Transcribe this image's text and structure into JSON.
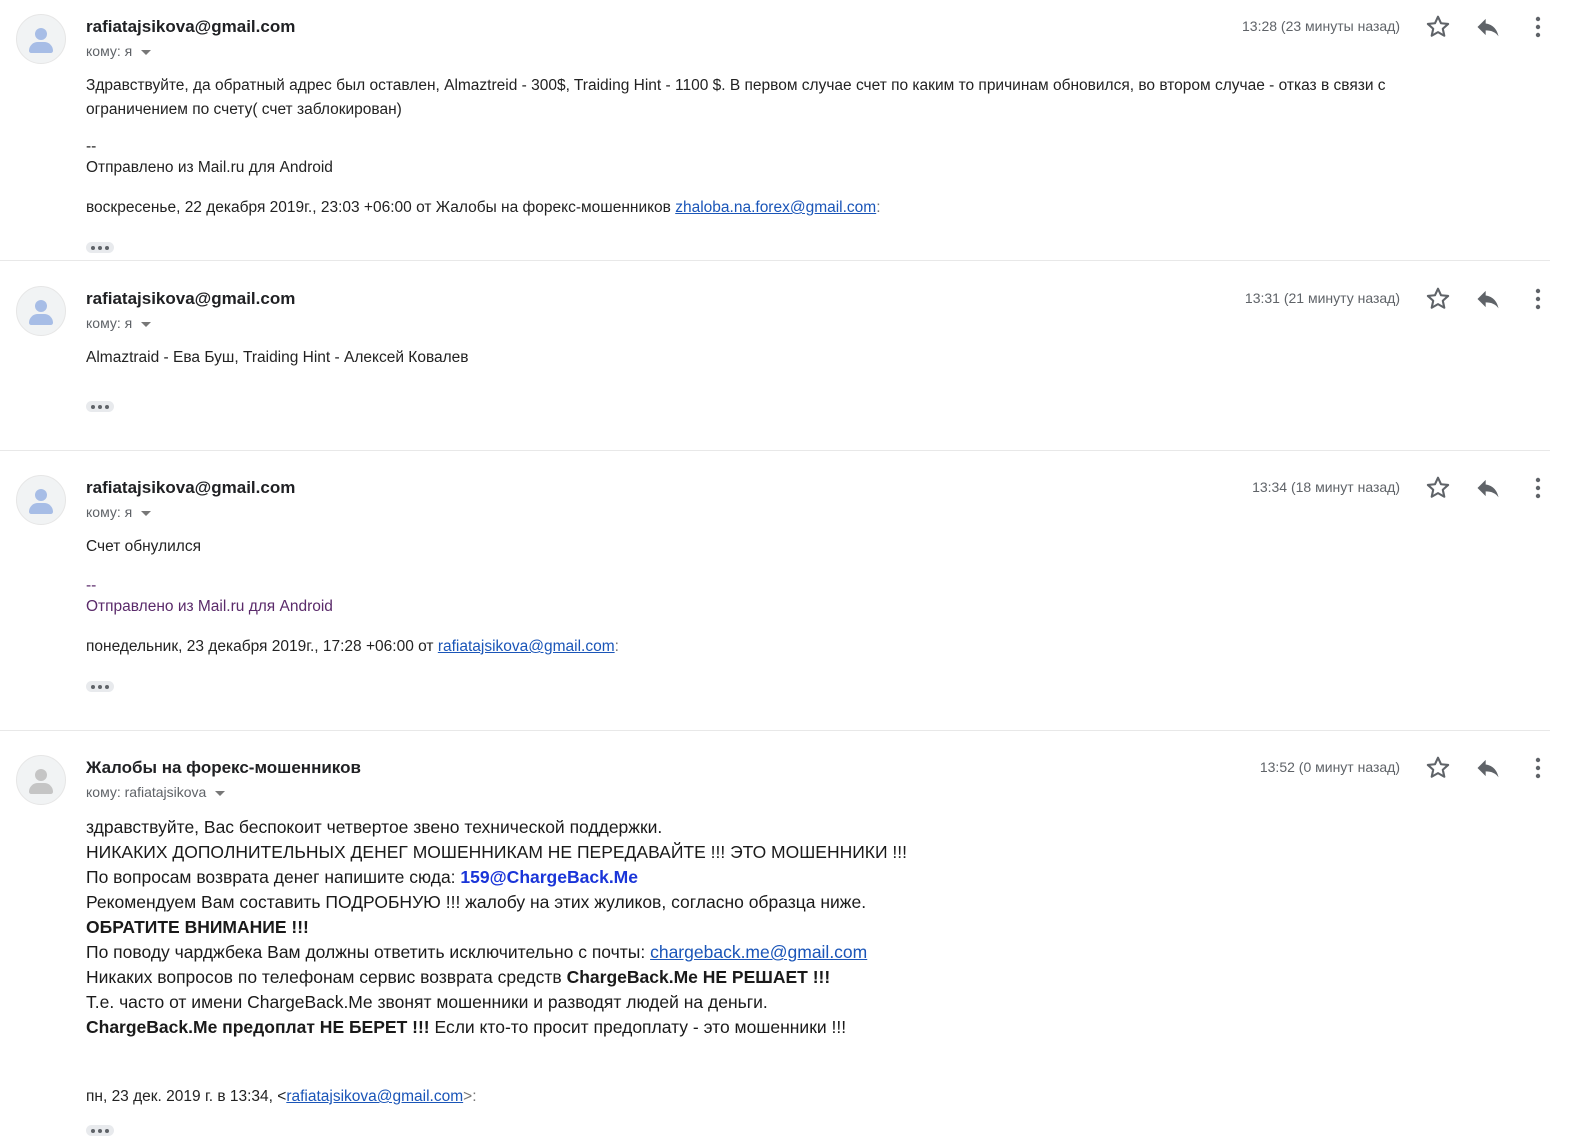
{
  "messages": [
    {
      "sender": "rafiatajsikova@gmail.com",
      "recipient": "кому: я",
      "time": "13:28 (23 минуты назад)",
      "body": [
        "Здравствуйте, да обратный адрес был оставлен, Almaztreid - 300$, Traiding Hint - 1100 $. В первом случае счет по каким то причинам обновился, во втором случае - отказ в связи с",
        "ограничением по счету( счет заблокирован)"
      ],
      "sig_dashes": "--",
      "sig_line": "Отправлено из Mail.ru для Android",
      "quote_prefix": "воскресенье, 22 декабря 2019г., 23:03 +06:00 от Жалобы на форекс-мошенников",
      "quote_email": "zhaloba.na.forex@gmail.com",
      "quote_suffix": ":"
    },
    {
      "sender": "rafiatajsikova@gmail.com",
      "recipient": "кому: я",
      "time": "13:31 (21 минуту назад)",
      "body": [
        "Almaztraid - Ева Буш, Traiding Hint - Алексей Ковалев"
      ]
    },
    {
      "sender": "rafiatajsikova@gmail.com",
      "recipient": "кому: я",
      "time": "13:34 (18 минут назад)",
      "body": [
        "Счет обнулился"
      ],
      "sig_dashes": "--",
      "sig_line": "Отправлено из Mail.ru для Android",
      "quote_prefix": "понедельник, 23 декабря 2019г., 17:28 +06:00 от",
      "quote_email": "rafiatajsikova@gmail.com",
      "quote_suffix": ":"
    },
    {
      "sender": "Жалобы на форекс-мошенников",
      "recipient": "кому: rafiatajsikova",
      "time": "13:52 (0 минут назад)",
      "lines": {
        "l1": "здравствуйте, Вас беспокоит четвертое звено технической поддержки.",
        "l2": "НИКАКИХ ДОПОЛНИТЕЛЬНЫХ ДЕНЕГ МОШЕННИКАМ НЕ ПЕРЕДАВАЙТЕ !!! ЭТО МОШЕННИКИ !!!",
        "l3_prefix": "По вопросам возврата денег напишите сюда:",
        "l3_email": "159@ChargeBack.Me",
        "l4": "Рекомендуем Вам составить ПОДРОБНУЮ !!! жалобу на этих жуликов, согласно образца ниже.",
        "l5": "ОБРАТИТЕ ВНИМАНИЕ !!!",
        "l6_prefix": "По поводу чарджбека Вам должны ответить исключительно с почты:",
        "l6_email": "chargeback.me@gmail.com",
        "l7_prefix": "Никаких вопросов по телефонам сервис возврата средств",
        "l7_bold": "ChargeBack.Me НЕ РЕШАЕТ !!!",
        "l8": "Т.е. часто от имени ChargeBack.Me звонят мошенники и разводят людей на деньги.",
        "l9_bold": "ChargeBack.Me предоплат НЕ БЕРЕТ !!!",
        "l9_suffix": "Если кто-то просит предоплату - это мошенники !!!"
      },
      "quote_prefix": "пн, 23 дек. 2019 г. в 13:34, <",
      "quote_email": "rafiatajsikova@gmail.com",
      "quote_suffix": ">:"
    }
  ],
  "icons": {
    "star": "star-icon",
    "reply": "reply-icon",
    "more": "more-vert-icon",
    "avatar": "person-avatar-icon"
  },
  "colors": {
    "link": "#1a55b8",
    "blue_bold": "#1a35d8",
    "meta": "#5f6368"
  }
}
